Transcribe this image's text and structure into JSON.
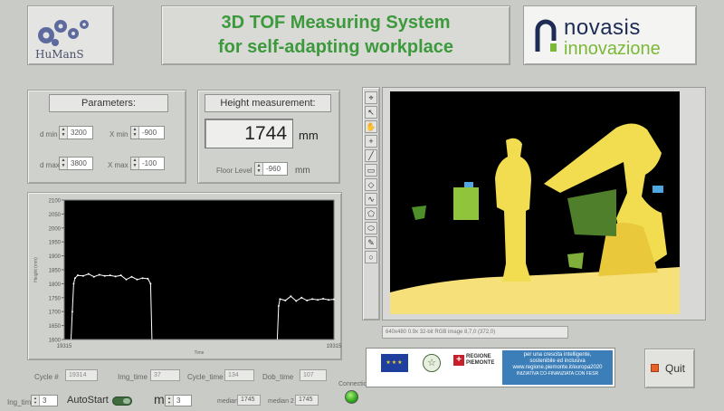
{
  "header": {
    "left_logo_text": "HuManS",
    "title_line1": "3D TOF Measuring System",
    "title_line2": "for self-adapting workplace",
    "right_logo_line1": "novasis",
    "right_logo_line2": "innovazione",
    "colors": {
      "title": "#3c9a3c",
      "brand_navy": "#1d2b55",
      "brand_green": "#7bb838"
    }
  },
  "parameters": {
    "title": "Parameters:",
    "d_min_label": "d min",
    "d_min_value": "3200",
    "x_min_label": "X min",
    "x_min_value": "-900",
    "d_max_label": "d max",
    "d_max_value": "3800",
    "x_max_label": "X max",
    "x_max_value": "-100"
  },
  "height": {
    "title": "Height measurement:",
    "value": "1744",
    "unit": "mm",
    "floor_label": "Floor Level",
    "floor_value": "-960",
    "floor_unit": "mm"
  },
  "chart_data": {
    "type": "line",
    "ylabel": "Height (mm)",
    "xlabel": "Time",
    "ylim": [
      1600,
      2100
    ],
    "yticks": [
      "2100",
      "2050",
      "2000",
      "1950",
      "1900",
      "1850",
      "1800",
      "1750",
      "1700",
      "1650",
      "1600"
    ],
    "xticks": [
      "19315",
      "19315"
    ],
    "series": [
      {
        "segments": [
          [
            [
              0.025,
              1600
            ],
            [
              0.03,
              1700
            ],
            [
              0.035,
              1800
            ],
            [
              0.04,
              1820
            ],
            [
              0.05,
              1830
            ],
            [
              0.07,
              1828
            ],
            [
              0.09,
              1835
            ],
            [
              0.11,
              1825
            ],
            [
              0.13,
              1832
            ],
            [
              0.15,
              1828
            ],
            [
              0.17,
              1830
            ],
            [
              0.19,
              1826
            ],
            [
              0.21,
              1830
            ],
            [
              0.23,
              1815
            ],
            [
              0.25,
              1825
            ],
            [
              0.27,
              1815
            ],
            [
              0.29,
              1820
            ],
            [
              0.31,
              1818
            ],
            [
              0.32,
              1800
            ],
            [
              0.325,
              1600
            ]
          ],
          [
            [
              0.79,
              1600
            ],
            [
              0.795,
              1720
            ],
            [
              0.8,
              1745
            ],
            [
              0.82,
              1740
            ],
            [
              0.84,
              1755
            ],
            [
              0.86,
              1738
            ],
            [
              0.88,
              1750
            ],
            [
              0.9,
              1740
            ],
            [
              0.92,
              1745
            ],
            [
              0.94,
              1742
            ],
            [
              0.96,
              1746
            ],
            [
              0.98,
              1742
            ],
            [
              1.0,
              1744
            ]
          ]
        ]
      }
    ],
    "grid": false,
    "background": "#000000",
    "line_color": "#ffffff"
  },
  "bottom_fields": {
    "cycle_label": "Cycle #",
    "cycle_value": "19314",
    "img_time_label": "Img_time",
    "img_time_value": "37",
    "cycle_time_label": "Cycle_time",
    "cycle_time_value": "134",
    "dob_time_label": "Dob_time",
    "dob_time_value": "107",
    "connection_label": "Connection"
  },
  "footer": {
    "ing_time_label": "Ing_time",
    "ing_time_value": "3",
    "autostart_label": "AutoStart",
    "m_label": "m",
    "m_value": "3",
    "median1_label": "median",
    "median1_value": "1745",
    "median2_label": "median 2",
    "median2_value": "1745"
  },
  "image_panel": {
    "status_text": "640x480 0.9x 32-bit RGB image 8,7,0    (372,0)",
    "tools": [
      "pointer-icon",
      "arrow-icon",
      "hand-icon",
      "crosshair-icon",
      "line-icon",
      "rectangle-icon",
      "diamond-icon",
      "freehand-icon",
      "polygon-icon",
      "ellipse-icon",
      "pen-icon",
      "circle-icon"
    ]
  },
  "eu_banner": {
    "regione_text": "REGIONE PIEMONTE",
    "slogan_line1": "per una crescita intelligente,",
    "slogan_line2": "sostenibile ed inclusiva",
    "url": "www.regione.piemonte.it/europa2020",
    "footer_text": "INIZIATIVA CO-FINANZIATA CON FESR"
  },
  "quit_label": "Quit"
}
